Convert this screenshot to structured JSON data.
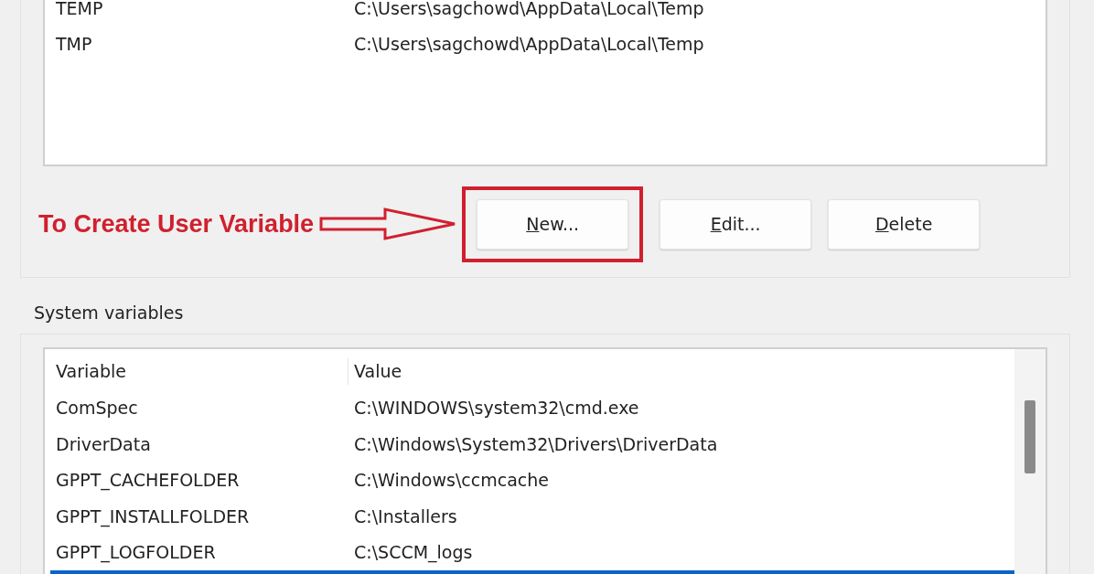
{
  "user_variables": {
    "rows": [
      {
        "variable": "TEMP",
        "value": "C:\\Users\\sagchowd\\AppData\\Local\\Temp"
      },
      {
        "variable": "TMP",
        "value": "C:\\Users\\sagchowd\\AppData\\Local\\Temp"
      }
    ],
    "annotation": {
      "text": "To Create User Variable",
      "color": "#d0202e"
    },
    "buttons": [
      {
        "label": "New...",
        "mnemonic": true,
        "highlighted": true
      },
      {
        "label": "Edit...",
        "mnemonic": true,
        "highlighted": false
      },
      {
        "label": "Delete",
        "mnemonic": true,
        "highlighted": false
      }
    ]
  },
  "system_variables": {
    "title": "System variables",
    "columns": [
      "Variable",
      "Value"
    ],
    "rows": [
      {
        "variable": "ComSpec",
        "value": "C:\\WINDOWS\\system32\\cmd.exe",
        "selected": false
      },
      {
        "variable": "DriverData",
        "value": "C:\\Windows\\System32\\Drivers\\DriverData",
        "selected": false
      },
      {
        "variable": "GPPT_CACHEFOLDER",
        "value": "C:\\Windows\\ccmcache",
        "selected": false
      },
      {
        "variable": "GPPT_INSTALLFOLDER",
        "value": "C:\\Installers",
        "selected": false
      },
      {
        "variable": "GPPT_LOGFOLDER",
        "value": "C:\\SCCM_logs",
        "selected": false
      },
      {
        "selected": true
      }
    ]
  }
}
